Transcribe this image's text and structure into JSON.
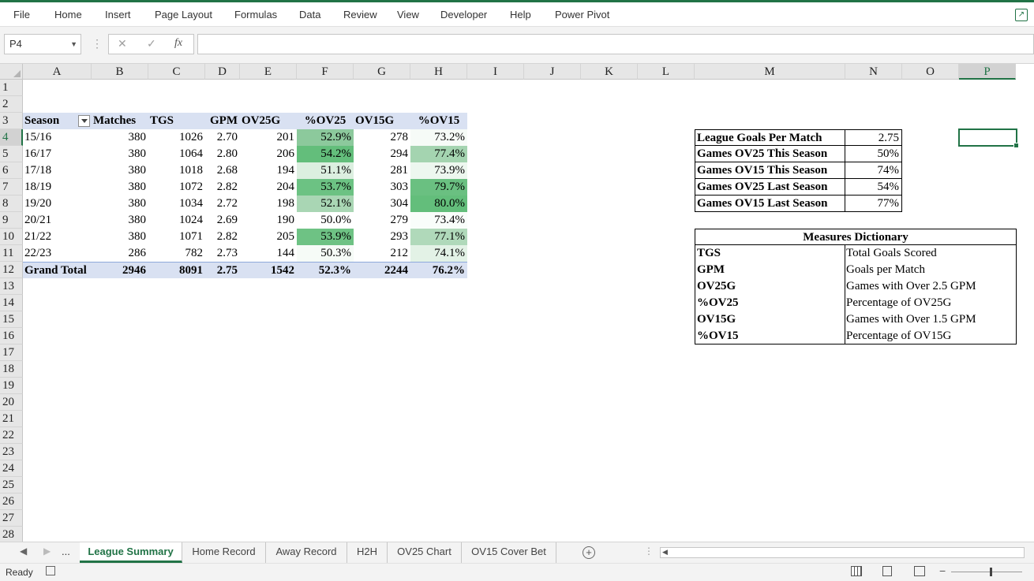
{
  "ribbon": {
    "tabs": [
      "File",
      "Home",
      "Insert",
      "Page Layout",
      "Formulas",
      "Data",
      "Review",
      "View",
      "Developer",
      "Help",
      "Power Pivot"
    ]
  },
  "formula_bar": {
    "name_box": "P4",
    "cancel": "✕",
    "enter": "✓",
    "fx": "fx",
    "content": ""
  },
  "columns": [
    "A",
    "B",
    "C",
    "D",
    "E",
    "F",
    "G",
    "H",
    "I",
    "J",
    "K",
    "L",
    "M",
    "N",
    "O",
    "P"
  ],
  "rows": [
    "1",
    "2",
    "3",
    "4",
    "5",
    "6",
    "7",
    "8",
    "9",
    "10",
    "11",
    "12",
    "13",
    "14",
    "15",
    "16",
    "17",
    "18",
    "19",
    "20",
    "21",
    "22",
    "23",
    "24",
    "25",
    "26",
    "27",
    "28"
  ],
  "pivot": {
    "headers": [
      "Season",
      "Matches",
      "TGS",
      "GPM",
      "OV25G",
      "%OV25",
      "OV15G",
      "%OV15"
    ],
    "rows": [
      [
        "15/16",
        "380",
        "1026",
        "2.70",
        "201",
        "52.9%",
        "278",
        "73.2%"
      ],
      [
        "16/17",
        "380",
        "1064",
        "2.80",
        "206",
        "54.2%",
        "294",
        "77.4%"
      ],
      [
        "17/18",
        "380",
        "1018",
        "2.68",
        "194",
        "51.1%",
        "281",
        "73.9%"
      ],
      [
        "18/19",
        "380",
        "1072",
        "2.82",
        "204",
        "53.7%",
        "303",
        "79.7%"
      ],
      [
        "19/20",
        "380",
        "1034",
        "2.72",
        "198",
        "52.1%",
        "304",
        "80.0%"
      ],
      [
        "20/21",
        "380",
        "1024",
        "2.69",
        "190",
        "50.0%",
        "279",
        "73.4%"
      ],
      [
        "21/22",
        "380",
        "1071",
        "2.82",
        "205",
        "53.9%",
        "293",
        "77.1%"
      ],
      [
        "22/23",
        "286",
        "782",
        "2.73",
        "144",
        "50.3%",
        "212",
        "74.1%"
      ]
    ],
    "total": [
      "Grand Total",
      "2946",
      "8091",
      "2.75",
      "1542",
      "52.3%",
      "2244",
      "76.2%"
    ],
    "ov25_colors": [
      "#8cc99c",
      "#63be7b",
      "#dcefe0",
      "#6cc283",
      "#a9d6b4",
      "#ffffff",
      "#6ec284",
      "#f6fbf7"
    ],
    "ov15_colors": [
      "#f6fbf7",
      "#a4d4b0",
      "#edf7ef",
      "#6ac081",
      "#63be7b",
      "#f9fdfa",
      "#b0d9ba",
      "#e3f2e6"
    ]
  },
  "summary": [
    {
      "label": "League Goals Per Match",
      "value": "2.75"
    },
    {
      "label": "Games OV25 This Season",
      "value": "50%"
    },
    {
      "label": "Games OV15 This Season",
      "value": "74%"
    },
    {
      "label": "Games OV25 Last Season",
      "value": "54%"
    },
    {
      "label": "Games OV15 Last Season",
      "value": "77%"
    }
  ],
  "dictionary": {
    "title": "Measures Dictionary",
    "items": [
      {
        "term": "TGS",
        "definition": "Total Goals Scored"
      },
      {
        "term": "GPM",
        "definition": "Goals per Match"
      },
      {
        "term": "OV25G",
        "definition": "Games with Over 2.5 GPM"
      },
      {
        "term": "%OV25",
        "definition": "Percentage of OV25G"
      },
      {
        "term": "OV15G",
        "definition": "Games with Over 1.5 GPM"
      },
      {
        "term": "%OV15",
        "definition": "Percentage of OV15G"
      }
    ]
  },
  "sheets": {
    "ellipsis": "...",
    "tabs": [
      "League Summary",
      "Home Record",
      "Away Record",
      "H2H",
      "OV25 Chart",
      "OV15 Cover Bet"
    ],
    "active": "League Summary"
  },
  "status": {
    "text": "Ready"
  },
  "accent": "#217346"
}
